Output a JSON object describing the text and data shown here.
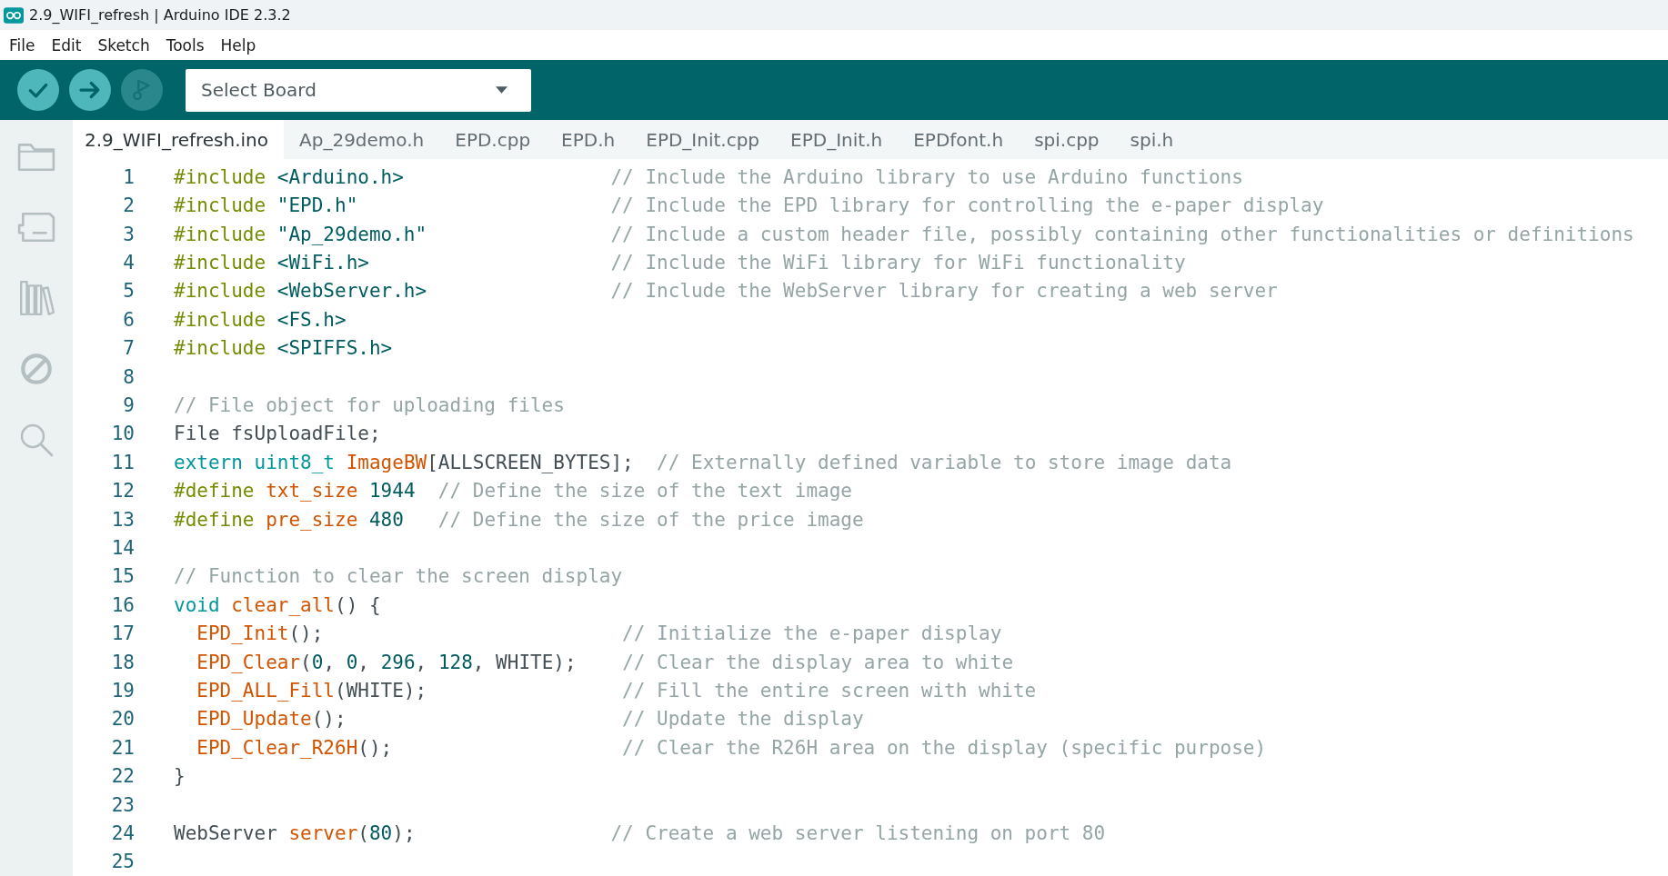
{
  "window": {
    "title": "2.9_WIFI_refresh | Arduino IDE 2.3.2"
  },
  "menu": [
    "File",
    "Edit",
    "Sketch",
    "Tools",
    "Help"
  ],
  "toolbar": {
    "buttons": [
      {
        "kind": "verify",
        "disabled": false
      },
      {
        "kind": "upload",
        "disabled": false
      },
      {
        "kind": "debug",
        "disabled": true
      }
    ],
    "board_select": {
      "value": "Select Board"
    }
  },
  "sidebar": {
    "items": [
      {
        "kind": "folder"
      },
      {
        "kind": "boards"
      },
      {
        "kind": "library"
      },
      {
        "kind": "debug"
      },
      {
        "kind": "search"
      }
    ]
  },
  "tabs": [
    {
      "label": "2.9_WIFI_refresh.ino",
      "selected": true
    },
    {
      "label": "Ap_29demo.h",
      "selected": false
    },
    {
      "label": "EPD.cpp",
      "selected": false
    },
    {
      "label": "EPD.h",
      "selected": false
    },
    {
      "label": "EPD_Init.cpp",
      "selected": false
    },
    {
      "label": "EPD_Init.h",
      "selected": false
    },
    {
      "label": "EPDfont.h",
      "selected": false
    },
    {
      "label": "spi.cpp",
      "selected": false
    },
    {
      "label": "spi.h",
      "selected": false
    }
  ],
  "editor": {
    "lines": [
      {
        "number": "1",
        "tokens": [
          {
            "kind": "directive",
            "text": "#include"
          },
          {
            "kind": "header",
            "text": " <Arduino.h>                  "
          },
          {
            "kind": "comment",
            "text": "// Include the Arduino library to use Arduino functions"
          }
        ]
      },
      {
        "number": "2",
        "tokens": [
          {
            "kind": "directive",
            "text": "#include"
          },
          {
            "kind": "header",
            "text": " \"EPD.h\"                      "
          },
          {
            "kind": "comment",
            "text": "// Include the EPD library for controlling the e-paper display"
          }
        ]
      },
      {
        "number": "3",
        "tokens": [
          {
            "kind": "directive",
            "text": "#include"
          },
          {
            "kind": "header",
            "text": " \"Ap_29demo.h\"                "
          },
          {
            "kind": "comment",
            "text": "// Include a custom header file, possibly containing other functionalities or definitions"
          }
        ]
      },
      {
        "number": "4",
        "tokens": [
          {
            "kind": "directive",
            "text": "#include"
          },
          {
            "kind": "header",
            "text": " <WiFi.h>                     "
          },
          {
            "kind": "comment",
            "text": "// Include the WiFi library for WiFi functionality"
          }
        ]
      },
      {
        "number": "5",
        "tokens": [
          {
            "kind": "directive",
            "text": "#include"
          },
          {
            "kind": "header",
            "text": " <WebServer.h>                "
          },
          {
            "kind": "comment",
            "text": "// Include the WebServer library for creating a web server"
          }
        ]
      },
      {
        "number": "6",
        "tokens": [
          {
            "kind": "directive",
            "text": "#include"
          },
          {
            "kind": "header",
            "text": " <FS.h>"
          }
        ]
      },
      {
        "number": "7",
        "tokens": [
          {
            "kind": "directive",
            "text": "#include"
          },
          {
            "kind": "header",
            "text": " <SPIFFS.h>"
          }
        ]
      },
      {
        "number": "8"
      },
      {
        "number": "9",
        "tokens": [
          {
            "kind": "comment",
            "text": "// File object for uploading files"
          }
        ]
      },
      {
        "number": "10",
        "tokens": [
          {
            "kind": "plain",
            "text": "File fsUploadFile;"
          }
        ]
      },
      {
        "number": "11",
        "tokens": [
          {
            "kind": "keyword",
            "text": "extern "
          },
          {
            "kind": "keyword",
            "text": "uint8_t "
          },
          {
            "kind": "function",
            "text": "ImageBW"
          },
          {
            "kind": "plain",
            "text": "[ALLSCREEN_BYTES];  "
          },
          {
            "kind": "comment",
            "text": "// Externally defined variable to store image data"
          }
        ]
      },
      {
        "number": "12",
        "tokens": [
          {
            "kind": "directive",
            "text": "#define "
          },
          {
            "kind": "function",
            "text": "txt_size "
          },
          {
            "kind": "number",
            "text": "1944  "
          },
          {
            "kind": "comment",
            "text": "// Define the size of the text image"
          }
        ]
      },
      {
        "number": "13",
        "tokens": [
          {
            "kind": "directive",
            "text": "#define "
          },
          {
            "kind": "function",
            "text": "pre_size "
          },
          {
            "kind": "number",
            "text": "480   "
          },
          {
            "kind": "comment",
            "text": "// Define the size of the price image"
          }
        ]
      },
      {
        "number": "14"
      },
      {
        "number": "15",
        "tokens": [
          {
            "kind": "comment",
            "text": "// Function to clear the screen display"
          }
        ]
      },
      {
        "number": "16",
        "tokens": [
          {
            "kind": "keyword",
            "text": "void "
          },
          {
            "kind": "function",
            "text": "clear_all"
          },
          {
            "kind": "plain",
            "text": "() {"
          }
        ]
      },
      {
        "number": "17",
        "tokens": [
          {
            "kind": "function",
            "text": "  EPD_Init"
          },
          {
            "kind": "plain",
            "text": "();                          "
          },
          {
            "kind": "comment",
            "text": "// Initialize the e-paper display"
          }
        ]
      },
      {
        "number": "18",
        "tokens": [
          {
            "kind": "function",
            "text": "  EPD_Clear"
          },
          {
            "kind": "plain",
            "text": "("
          },
          {
            "kind": "number",
            "text": "0"
          },
          {
            "kind": "plain",
            "text": ", "
          },
          {
            "kind": "number",
            "text": "0"
          },
          {
            "kind": "plain",
            "text": ", "
          },
          {
            "kind": "number",
            "text": "296"
          },
          {
            "kind": "plain",
            "text": ", "
          },
          {
            "kind": "number",
            "text": "128"
          },
          {
            "kind": "plain",
            "text": ", WHITE);    "
          },
          {
            "kind": "comment",
            "text": "// Clear the display area to white"
          }
        ]
      },
      {
        "number": "19",
        "tokens": [
          {
            "kind": "function",
            "text": "  EPD_ALL_Fill"
          },
          {
            "kind": "plain",
            "text": "(WHITE);                 "
          },
          {
            "kind": "comment",
            "text": "// Fill the entire screen with white"
          }
        ]
      },
      {
        "number": "20",
        "tokens": [
          {
            "kind": "function",
            "text": "  EPD_Update"
          },
          {
            "kind": "plain",
            "text": "();                        "
          },
          {
            "kind": "comment",
            "text": "// Update the display"
          }
        ]
      },
      {
        "number": "21",
        "tokens": [
          {
            "kind": "function",
            "text": "  EPD_Clear_R26H"
          },
          {
            "kind": "plain",
            "text": "();                    "
          },
          {
            "kind": "comment",
            "text": "// Clear the R26H area on the display (specific purpose)"
          }
        ]
      },
      {
        "number": "22",
        "tokens": [
          {
            "kind": "plain",
            "text": "}"
          }
        ]
      },
      {
        "number": "23"
      },
      {
        "number": "24",
        "tokens": [
          {
            "kind": "plain",
            "text": "WebServer "
          },
          {
            "kind": "function",
            "text": "server"
          },
          {
            "kind": "plain",
            "text": "("
          },
          {
            "kind": "number",
            "text": "80"
          },
          {
            "kind": "plain",
            "text": ");                 "
          },
          {
            "kind": "comment",
            "text": "// Create a web server listening on port 80"
          }
        ]
      },
      {
        "number": "25"
      }
    ]
  }
}
